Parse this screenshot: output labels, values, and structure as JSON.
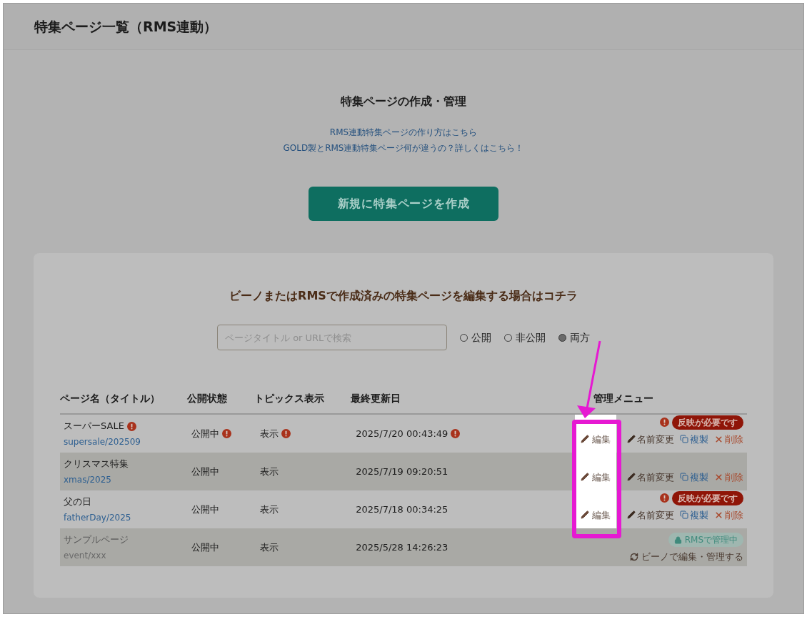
{
  "header": {
    "title": "特集ページ一覧（RMS連動）"
  },
  "intro": {
    "heading": "特集ページの作成・管理",
    "links": [
      "RMS連動特集ページの作り方はこちら",
      "GOLD製とRMS連動特集ページ何が違うの？詳しくはこちら！"
    ],
    "create_button": "新規に特集ページを作成"
  },
  "card": {
    "heading": "ビーノまたはRMSで作成済みの特集ページを編集する場合はコチラ",
    "search": {
      "placeholder": "ページタイトル or URLで検索"
    },
    "filters": [
      {
        "label": "公開",
        "selected": false
      },
      {
        "label": "非公開",
        "selected": false
      },
      {
        "label": "両方",
        "selected": true
      }
    ]
  },
  "table": {
    "columns": [
      "ページ名（タイトル）",
      "公開状態",
      "トピックス表示",
      "最終更新日",
      "管理メニュー"
    ],
    "rows": [
      {
        "kind": "bino",
        "title": "スーパーSALE",
        "path": "supersale/202509",
        "warning": true,
        "status": "公開中",
        "topics": "表示",
        "updated": "2025/7/20 00:43:49",
        "badge": "反映が必要です",
        "actions": [
          "編集",
          "名前変更",
          "複製",
          "削除"
        ]
      },
      {
        "kind": "bino",
        "title": "クリスマス特集",
        "path": "xmas/2025",
        "warning": false,
        "status": "公開中",
        "topics": "表示",
        "updated": "2025/7/19 09:20:51",
        "actions": [
          "編集",
          "名前変更",
          "複製",
          "削除"
        ]
      },
      {
        "kind": "bino",
        "title": "父の日",
        "path": "fatherDay/2025",
        "warning": false,
        "status": "公開中",
        "topics": "表示",
        "updated": "2025/7/18 00:34:25",
        "badge": "反映が必要です",
        "actions": [
          "編集",
          "名前変更",
          "複製",
          "削除"
        ]
      },
      {
        "kind": "rms",
        "title": "サンプルページ",
        "path": "event/xxx",
        "warning": false,
        "status": "公開中",
        "topics": "表示",
        "updated": "2025/5/28 14:26:23",
        "badge": "RMSで管理中",
        "actions": [
          "ビーノで編集・管理する"
        ]
      }
    ]
  }
}
